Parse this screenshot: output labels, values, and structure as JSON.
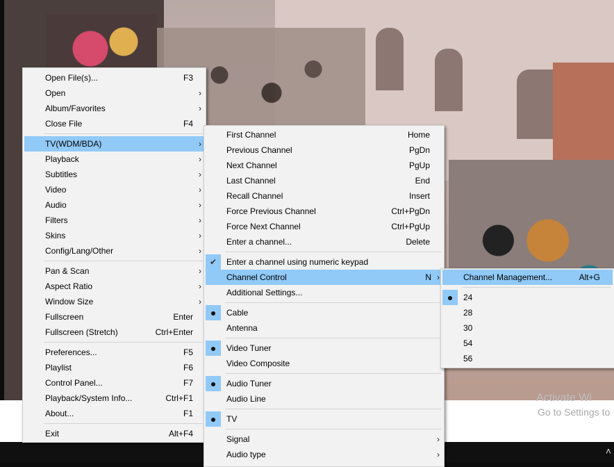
{
  "main_menu": {
    "items": [
      {
        "label": "Open File(s)...",
        "shortcut": "F3"
      },
      {
        "label": "Open",
        "submenu": true
      },
      {
        "label": "Album/Favorites",
        "submenu": true
      },
      {
        "label": "Close File",
        "shortcut": "F4"
      },
      {
        "label": "TV(WDM/BDA)",
        "submenu": true
      },
      {
        "label": "Playback",
        "submenu": true
      },
      {
        "label": "Subtitles",
        "submenu": true
      },
      {
        "label": "Video",
        "submenu": true
      },
      {
        "label": "Audio",
        "submenu": true
      },
      {
        "label": "Filters",
        "submenu": true
      },
      {
        "label": "Skins",
        "submenu": true
      },
      {
        "label": "Config/Lang/Other",
        "submenu": true
      },
      {
        "label": "Pan & Scan",
        "submenu": true
      },
      {
        "label": "Aspect Ratio",
        "submenu": true
      },
      {
        "label": "Window Size",
        "submenu": true
      },
      {
        "label": "Fullscreen",
        "shortcut": "Enter"
      },
      {
        "label": "Fullscreen (Stretch)",
        "shortcut": "Ctrl+Enter"
      },
      {
        "label": "Preferences...",
        "shortcut": "F5"
      },
      {
        "label": "Playlist",
        "shortcut": "F6"
      },
      {
        "label": "Control Panel...",
        "shortcut": "F7"
      },
      {
        "label": "Playback/System Info...",
        "shortcut": "Ctrl+F1"
      },
      {
        "label": "About...",
        "shortcut": "F1"
      },
      {
        "label": "Exit",
        "shortcut": "Alt+F4"
      }
    ]
  },
  "tv_menu": {
    "items": [
      {
        "label": "First Channel",
        "shortcut": "Home"
      },
      {
        "label": "Previous Channel",
        "shortcut": "PgDn"
      },
      {
        "label": "Next Channel",
        "shortcut": "PgUp"
      },
      {
        "label": "Last Channel",
        "shortcut": "End"
      },
      {
        "label": "Recall Channel",
        "shortcut": "Insert"
      },
      {
        "label": "Force Previous Channel",
        "shortcut": "Ctrl+PgDn"
      },
      {
        "label": "Force Next Channel",
        "shortcut": "Ctrl+PgUp"
      },
      {
        "label": "Enter a channel...",
        "shortcut": "Delete"
      },
      {
        "label": "Enter a channel using numeric keypad",
        "checked": true
      },
      {
        "label": "Channel Control",
        "shortcut": "N",
        "submenu": true
      },
      {
        "label": "Additional Settings..."
      },
      {
        "label": "Cable",
        "selected": true
      },
      {
        "label": "Antenna"
      },
      {
        "label": "Video Tuner",
        "selected": true
      },
      {
        "label": "Video Composite"
      },
      {
        "label": "Audio Tuner",
        "selected": true
      },
      {
        "label": "Audio Line"
      },
      {
        "label": "TV",
        "selected": true
      },
      {
        "label": "Signal",
        "submenu": true
      },
      {
        "label": "Audio type",
        "submenu": true
      }
    ]
  },
  "channel_menu": {
    "items": [
      {
        "label": "Channel Management...",
        "shortcut": "Alt+G"
      },
      {
        "label": "24",
        "selected": true
      },
      {
        "label": "28"
      },
      {
        "label": "30"
      },
      {
        "label": "54"
      },
      {
        "label": "56"
      }
    ]
  },
  "watermark": {
    "line1": "Activate Wi",
    "line2": "Go to Settings to"
  },
  "colors": {
    "highlight": "#91c9f7",
    "menu_bg": "#f2f2f2"
  }
}
